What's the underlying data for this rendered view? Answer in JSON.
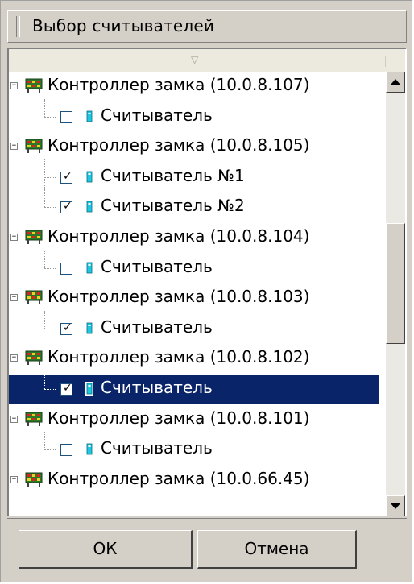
{
  "dialog": {
    "title": "Выбор считывателей"
  },
  "tree": {
    "items": [
      {
        "kind": "controller",
        "label": "Контроллер замка (10.0.8.107)",
        "expanded": true
      },
      {
        "kind": "reader",
        "label": "Считыватель",
        "checked": false,
        "last": true
      },
      {
        "kind": "controller",
        "label": "Контроллер замка (10.0.8.105)",
        "expanded": true
      },
      {
        "kind": "reader",
        "label": "Считыватель №1",
        "checked": true,
        "last": false
      },
      {
        "kind": "reader",
        "label": "Считыватель №2",
        "checked": true,
        "last": true
      },
      {
        "kind": "controller",
        "label": "Контроллер замка (10.0.8.104)",
        "expanded": true
      },
      {
        "kind": "reader",
        "label": "Считыватель",
        "checked": false,
        "last": true
      },
      {
        "kind": "controller",
        "label": "Контроллер замка (10.0.8.103)",
        "expanded": true
      },
      {
        "kind": "reader",
        "label": "Считыватель",
        "checked": true,
        "last": true
      },
      {
        "kind": "controller",
        "label": "Контроллер замка (10.0.8.102)",
        "expanded": true
      },
      {
        "kind": "reader",
        "label": "Считыватель",
        "checked": true,
        "last": true,
        "selected": true
      },
      {
        "kind": "controller",
        "label": "Контроллер замка (10.0.8.101)",
        "expanded": true
      },
      {
        "kind": "reader",
        "label": "Считыватель",
        "checked": false,
        "last": true
      },
      {
        "kind": "controller",
        "label": "Контроллер замка (10.0.66.45)",
        "expanded": true
      }
    ],
    "expander_glyph": "−",
    "check_glyph": "✓",
    "sort_glyph": "▽"
  },
  "icons": {
    "controller": "lock-controller-icon",
    "reader": "card-reader-icon"
  },
  "colors": {
    "selection": "#0a246a",
    "reader_icon": "#1ec8e0",
    "controller_body": "#2a7a2a"
  },
  "buttons": {
    "ok": "ОК",
    "cancel": "Отмена"
  }
}
